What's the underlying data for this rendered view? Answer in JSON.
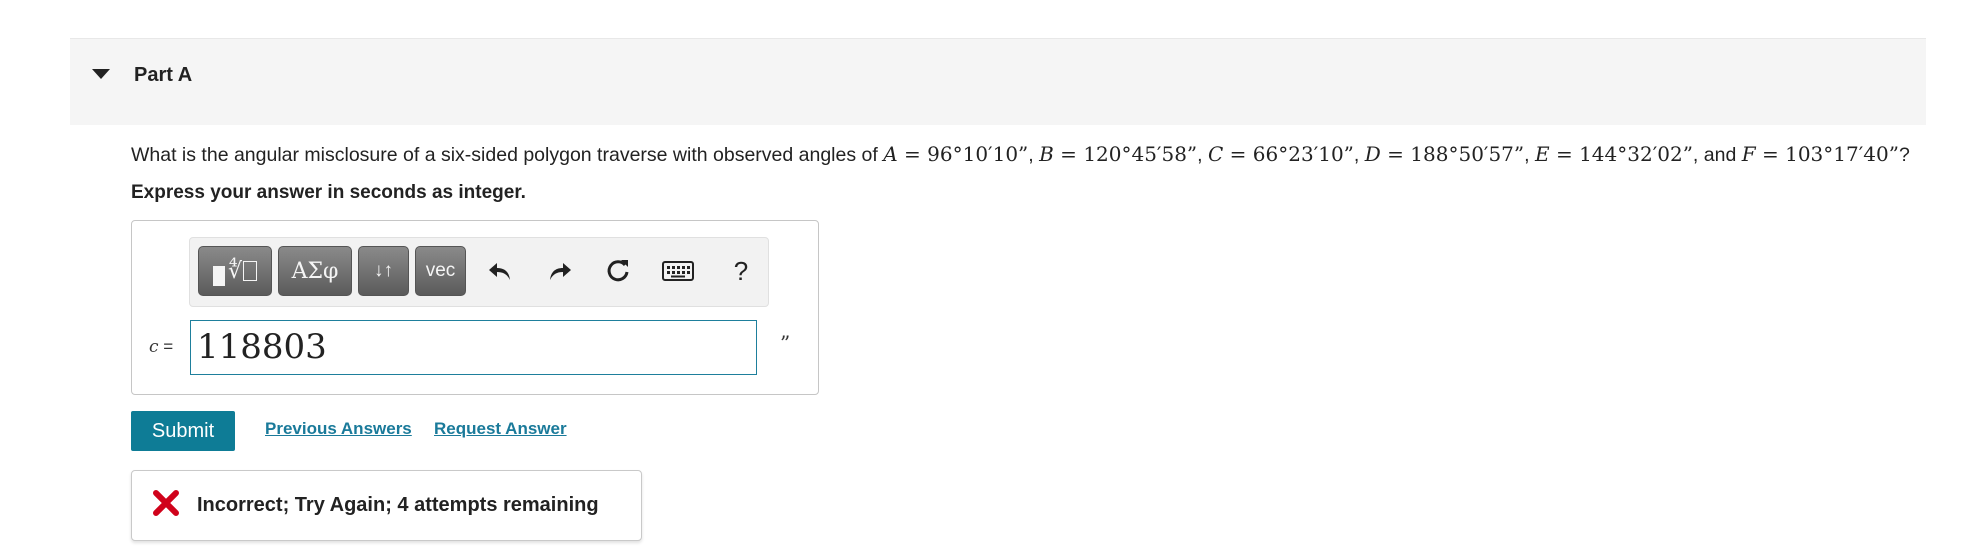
{
  "part": {
    "title": "Part A"
  },
  "question": {
    "intro": "What is the angular misclosure of a six-sided polygon traverse with observed angles of",
    "angles": [
      {
        "var": "A",
        "value": "96°10′10”"
      },
      {
        "var": "B",
        "value": "120°45′58”"
      },
      {
        "var": "C",
        "value": "66°23′10”"
      },
      {
        "var": "D",
        "value": "188°50′57”"
      },
      {
        "var": "E",
        "value": "144°32′02”"
      },
      {
        "var": "F",
        "value": "103°17′40”"
      }
    ],
    "conjunction": "and",
    "end_mark": "?",
    "instruction": "Express your answer in seconds as integer."
  },
  "toolbar": {
    "greek_label": "ΑΣφ",
    "arrows_label": "↓↑",
    "vec_label": "vec",
    "help_label": "?",
    "icons": [
      "templates-icon",
      "undo-icon",
      "redo-icon",
      "reset-icon",
      "keyboard-icon",
      "help-icon"
    ]
  },
  "answer": {
    "variable": "c",
    "equals": "=",
    "value": "118803",
    "unit": "”"
  },
  "actions": {
    "submit_label": "Submit",
    "previous_answers_label": "Previous Answers",
    "request_answer_label": "Request Answer"
  },
  "feedback": {
    "text": "Incorrect; Try Again; 4 attempts remaining",
    "icon": "x-icon",
    "status_color": "#d0021b"
  },
  "colors": {
    "accent": "#0e7c96",
    "link": "#1a7a9a",
    "error": "#d0021b"
  }
}
